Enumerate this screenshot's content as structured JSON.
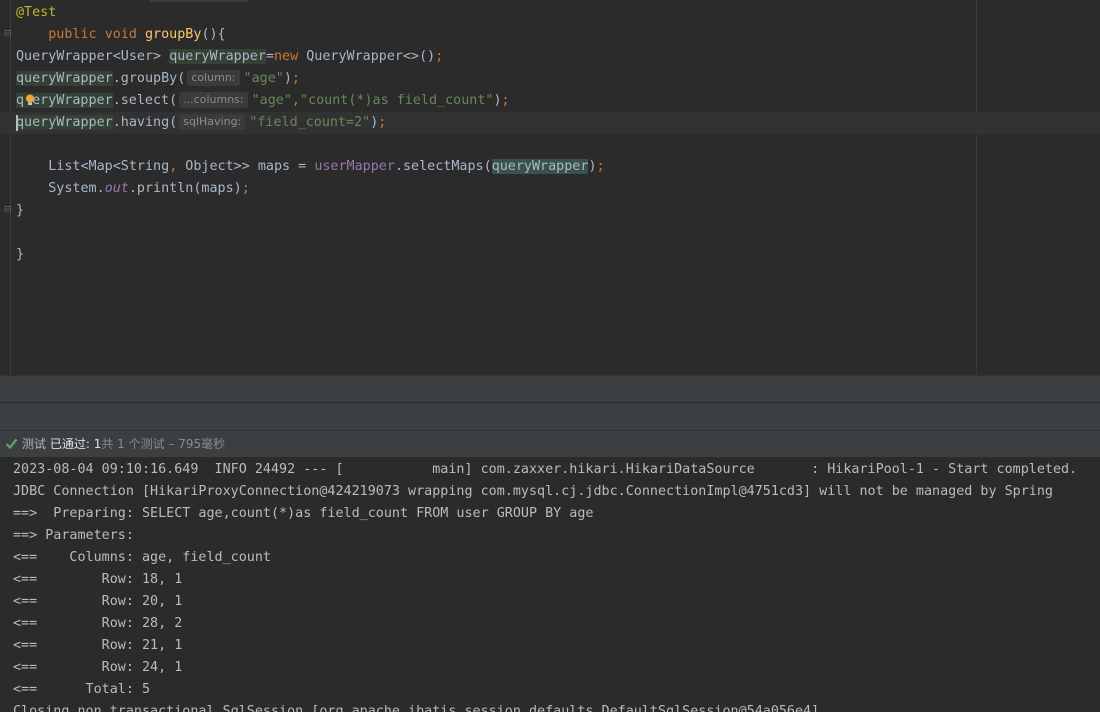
{
  "editor": {
    "line1": {
      "annotation": "@Test"
    },
    "line2": {
      "kw_public": "public",
      "kw_void": "void",
      "method": "groupBy",
      "rest": "(){"
    },
    "line3": {
      "type": "QueryWrapper<User> ",
      "var": "queryWrapper",
      "eq": "=",
      "kw_new": "new",
      "rest": " QueryWrapper<>()",
      "semi": ";"
    },
    "line4": {
      "var": "queryWrapper",
      "call": ".groupBy(",
      "hint": "column:",
      "arg": "\"age\"",
      "close": ")",
      "semi": ";"
    },
    "line5": {
      "var_a": "q",
      "var_b": "eryWrapper",
      "call": ".select(",
      "hint": "...columns:",
      "arg1": "\"age\"",
      "comma": ",",
      "arg2": "\"count(*)as field_count\"",
      "close": ")",
      "semi": ";"
    },
    "line6": {
      "var": "queryWrapper",
      "call": ".having(",
      "hint": "sqlHaving:",
      "arg": "\"field_count=2\"",
      "close": ")",
      "semi": ";"
    },
    "line8": {
      "type": "List<Map<String",
      "comma": ",",
      "rest": " Object>> maps = ",
      "field": "userMapper",
      "call": ".selectMaps(",
      "arg": "queryWrapper",
      "close": ")",
      "semi": ";"
    },
    "line9": {
      "cls": "System.",
      "out": "out",
      "rest": ".println(maps)",
      "semi": ";"
    },
    "line10": {
      "brace": "}"
    },
    "line12": {
      "brace": "}"
    }
  },
  "status": {
    "test_label": "测试",
    "passed_label": "已通过: 1",
    "total_text": "共 1 个测试",
    "duration": " – 795毫秒",
    "check_icon": "check-icon",
    "check_color": "#59a869"
  },
  "console": {
    "lines": [
      "2023-08-04 09:10:16.649  INFO 24492 --- [           main] com.zaxxer.hikari.HikariDataSource       : HikariPool-1 - Start completed.",
      "JDBC Connection [HikariProxyConnection@424219073 wrapping com.mysql.cj.jdbc.ConnectionImpl@4751cd3] will not be managed by Spring",
      "==>  Preparing: SELECT age,count(*)as field_count FROM user GROUP BY age",
      "==> Parameters: ",
      "<==    Columns: age, field_count",
      "<==        Row: 18, 1",
      "<==        Row: 20, 1",
      "<==        Row: 28, 2",
      "<==        Row: 21, 1",
      "<==        Row: 24, 1",
      "<==      Total: 5",
      "Closing non transactional SqlSession [org.apache.ibatis.session.defaults.DefaultSqlSession@54a056e4]"
    ]
  }
}
